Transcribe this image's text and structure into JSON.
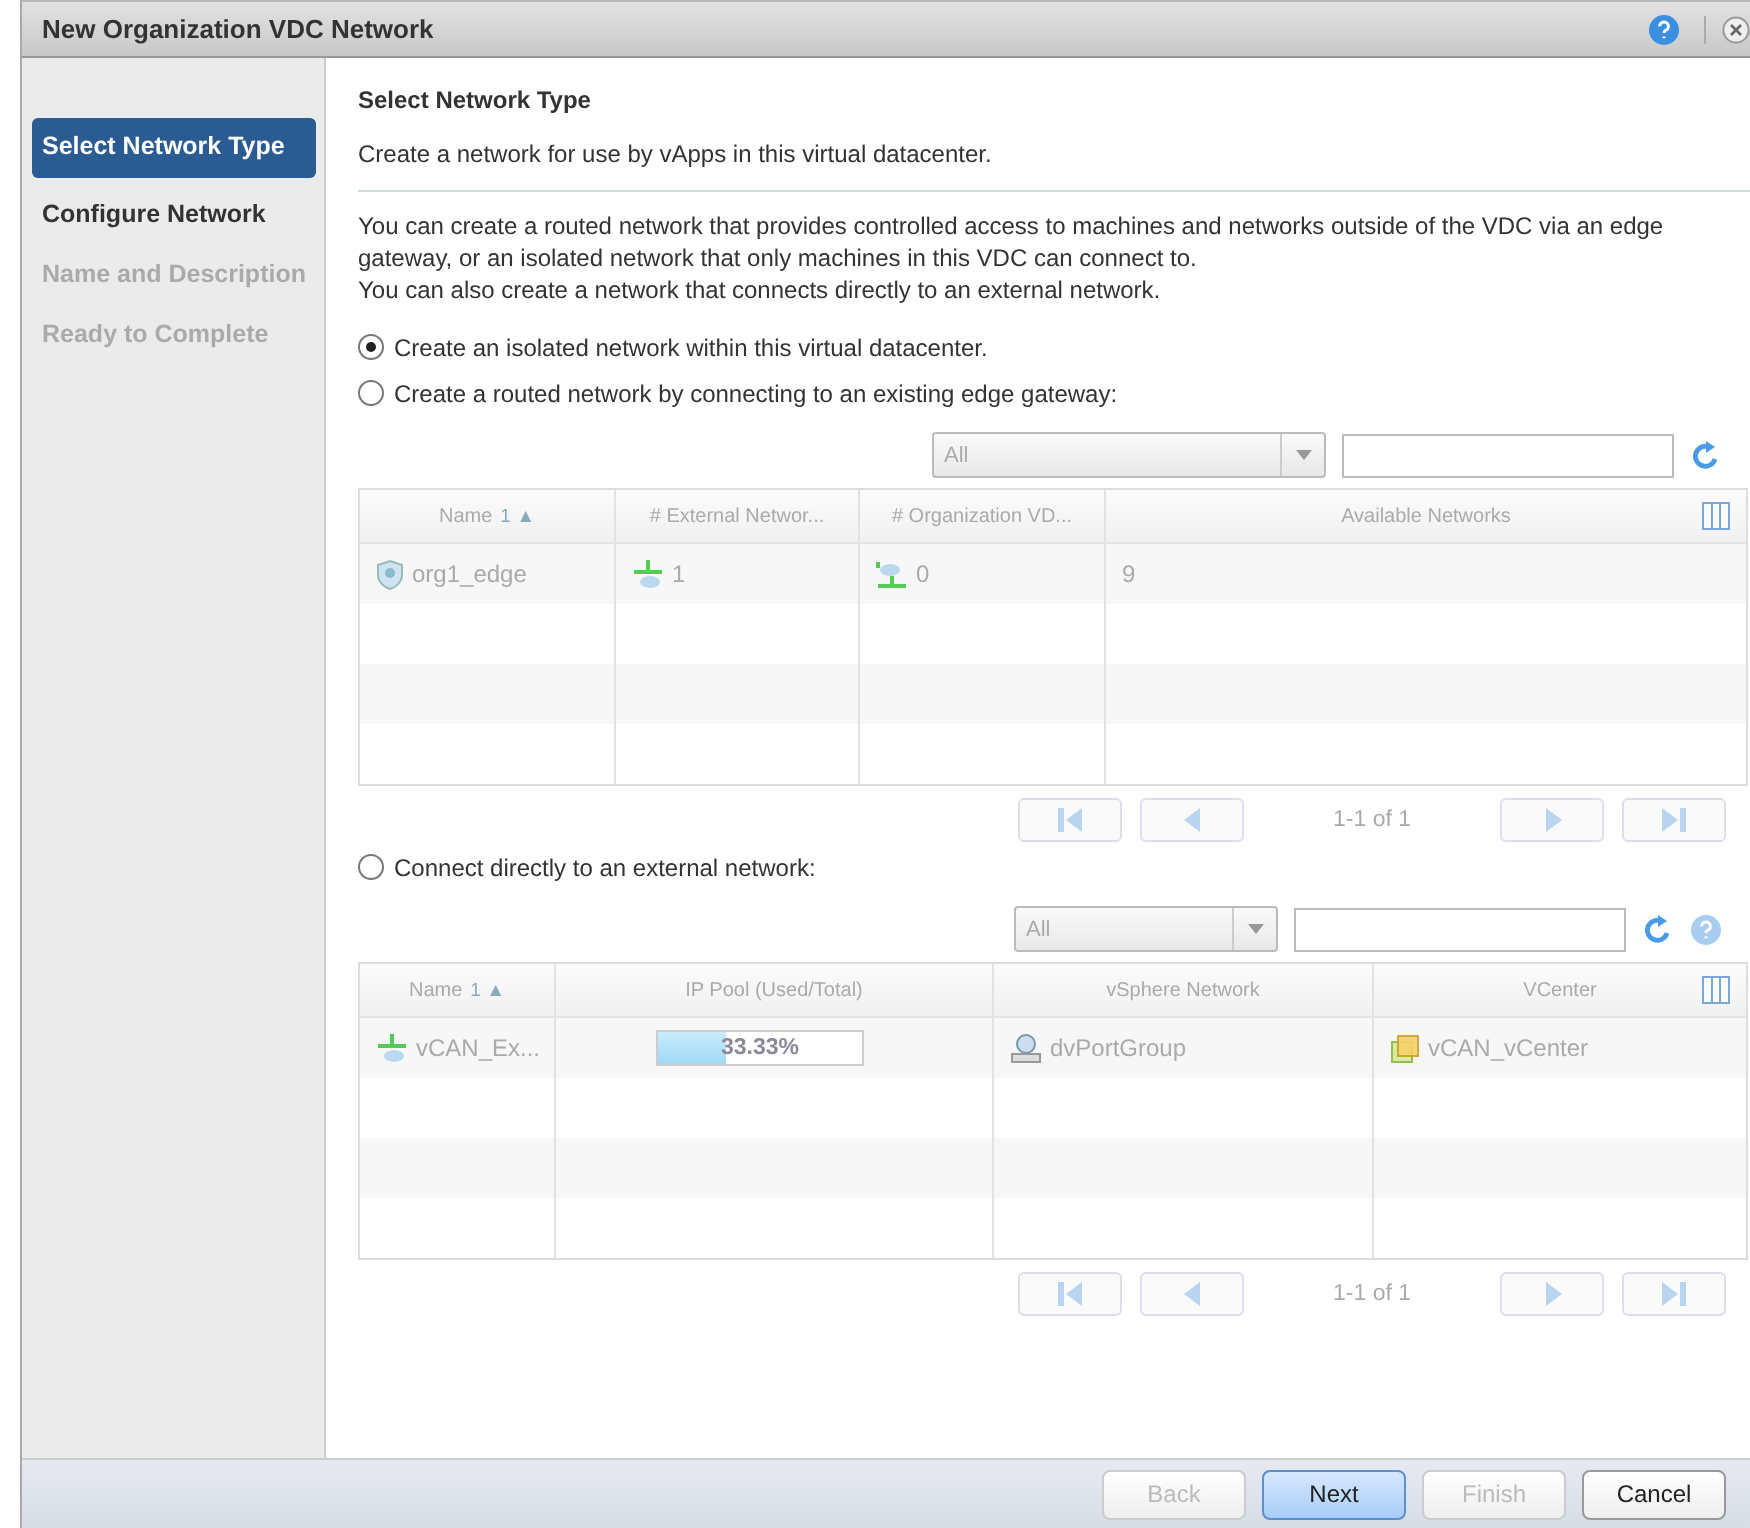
{
  "window": {
    "title": "New Organization VDC Network"
  },
  "sidebar": {
    "items": [
      {
        "label": "Select Network Type",
        "selected": true,
        "disabled": false
      },
      {
        "label": "Configure Network",
        "selected": false,
        "disabled": false
      },
      {
        "label": "Name and Description",
        "selected": false,
        "disabled": true
      },
      {
        "label": "Ready to Complete",
        "selected": false,
        "disabled": true
      }
    ]
  },
  "heading": "Select Network Type",
  "intro": "Create a network for use by vApps in this virtual datacenter.",
  "description": [
    "You can create a routed network that provides controlled access to machines and networks outside of the VDC via an edge gateway, or an isolated network that only machines in this VDC can connect to.",
    "You can also create a network that connects directly to an external network."
  ],
  "options": [
    {
      "label": "Create an isolated network within this virtual datacenter.",
      "selected": true
    },
    {
      "label": "Create a routed network by connecting to an existing edge gateway:",
      "selected": false,
      "grid": {
        "filter": "All",
        "columns": [
          {
            "label": "Name",
            "sort": "1 ▲"
          },
          {
            "label": "# External Networ..."
          },
          {
            "label": "# Organization VD..."
          },
          {
            "label": "Available Networks"
          }
        ],
        "rows": [
          {
            "cells": [
              {
                "kind": "gateway",
                "text": "org1_edge"
              },
              {
                "kind": "external",
                "text": "1"
              },
              {
                "kind": "orgnet",
                "text": "0"
              },
              {
                "kind": "plain",
                "text": "9"
              }
            ]
          }
        ],
        "pager": "1-1 of 1"
      }
    },
    {
      "label": "Connect directly to an external network:",
      "selected": false,
      "grid": {
        "filter": "All",
        "help": true,
        "columns": [
          {
            "label": "Name",
            "sort": "1 ▲"
          },
          {
            "label": "IP Pool (Used/Total)"
          },
          {
            "label": "vSphere Network"
          },
          {
            "label": "VCenter"
          }
        ],
        "rows": [
          {
            "cells": [
              {
                "kind": "external",
                "text": "vCAN_Ex..."
              },
              {
                "kind": "meter",
                "text": "33.33%",
                "level": 0.3333
              },
              {
                "kind": "portgroup",
                "text": "dvPortGroup"
              },
              {
                "kind": "vcenter",
                "text": "vCAN_vCenter"
              }
            ]
          }
        ],
        "pager": "1-1 of 1"
      }
    }
  ],
  "buttons": [
    {
      "label": "Back",
      "disabled": true,
      "default": false
    },
    {
      "label": "Next",
      "disabled": false,
      "default": true
    },
    {
      "label": "Finish",
      "disabled": true,
      "default": false
    },
    {
      "label": "Cancel",
      "disabled": false,
      "default": false
    }
  ]
}
